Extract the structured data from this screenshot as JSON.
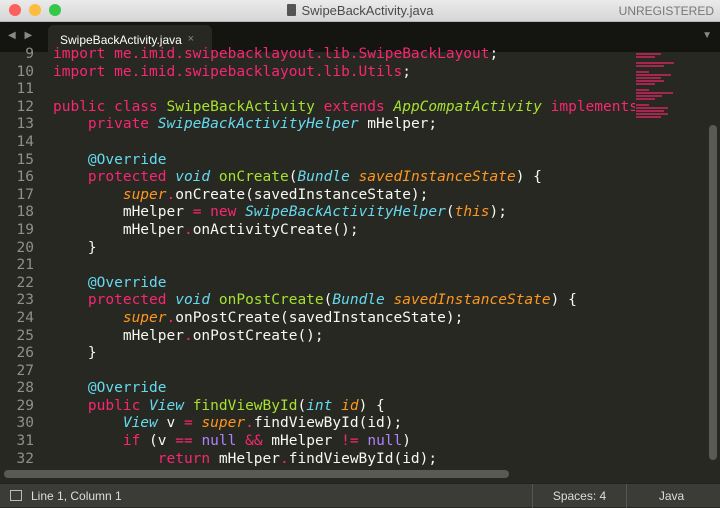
{
  "window": {
    "title": "SwipeBackActivity.java",
    "badge": "UNREGISTERED",
    "lights": [
      "#fc605b",
      "#fdbc40",
      "#34c84a"
    ]
  },
  "tabs": [
    {
      "label": "SwipeBackActivity.java",
      "close": "×"
    }
  ],
  "nav": {
    "arrows": "◀ ▶",
    "menu": "▼"
  },
  "code": [
    {
      "n": "9",
      "t": [
        [
          "import me.imid.swipebacklayout.lib.SwipeBackLayout",
          "k"
        ],
        [
          ";",
          "p"
        ]
      ]
    },
    {
      "n": "10",
      "t": [
        [
          "import me.imid.swipebacklayout.lib.Utils",
          "k"
        ],
        [
          ";",
          "p"
        ]
      ]
    },
    {
      "n": "11",
      "t": []
    },
    {
      "n": "12",
      "t": [
        [
          "public class ",
          "k"
        ],
        [
          "SwipeBackActivity ",
          "f"
        ],
        [
          "extends ",
          "k"
        ],
        [
          "AppCompatActivity ",
          "g"
        ],
        [
          "implements",
          "k"
        ]
      ]
    },
    {
      "n": "13",
      "t": [
        [
          "    private ",
          "k"
        ],
        [
          "SwipeBackActivityHelper",
          "t"
        ],
        [
          " mHelper;",
          "p"
        ]
      ]
    },
    {
      "n": "14",
      "t": []
    },
    {
      "n": "15",
      "t": [
        [
          "    @Override",
          "c"
        ]
      ]
    },
    {
      "n": "16",
      "t": [
        [
          "    protected ",
          "k"
        ],
        [
          "void ",
          "t"
        ],
        [
          "onCreate",
          "f"
        ],
        [
          "(",
          "p"
        ],
        [
          "Bundle ",
          "t"
        ],
        [
          "savedInstanceState",
          "a"
        ],
        [
          ") {",
          "p"
        ]
      ]
    },
    {
      "n": "17",
      "t": [
        [
          "        ",
          "p"
        ],
        [
          "super",
          "a"
        ],
        [
          ".",
          "k"
        ],
        [
          "onCreate(savedInstanceState);",
          "p"
        ]
      ]
    },
    {
      "n": "18",
      "t": [
        [
          "        mHelper ",
          "p"
        ],
        [
          "= new ",
          "k"
        ],
        [
          "SwipeBackActivityHelper",
          "t"
        ],
        [
          "(",
          "p"
        ],
        [
          "this",
          "a"
        ],
        [
          ");",
          "p"
        ]
      ]
    },
    {
      "n": "19",
      "t": [
        [
          "        mHelper",
          "p"
        ],
        [
          ".",
          "k"
        ],
        [
          "onActivityCreate();",
          "p"
        ]
      ]
    },
    {
      "n": "20",
      "t": [
        [
          "    }",
          "p"
        ]
      ]
    },
    {
      "n": "21",
      "t": []
    },
    {
      "n": "22",
      "t": [
        [
          "    @Override",
          "c"
        ]
      ]
    },
    {
      "n": "23",
      "t": [
        [
          "    protected ",
          "k"
        ],
        [
          "void ",
          "t"
        ],
        [
          "onPostCreate",
          "f"
        ],
        [
          "(",
          "p"
        ],
        [
          "Bundle ",
          "t"
        ],
        [
          "savedInstanceState",
          "a"
        ],
        [
          ") {",
          "p"
        ]
      ]
    },
    {
      "n": "24",
      "t": [
        [
          "        ",
          "p"
        ],
        [
          "super",
          "a"
        ],
        [
          ".",
          "k"
        ],
        [
          "onPostCreate(savedInstanceState);",
          "p"
        ]
      ]
    },
    {
      "n": "25",
      "t": [
        [
          "        mHelper",
          "p"
        ],
        [
          ".",
          "k"
        ],
        [
          "onPostCreate();",
          "p"
        ]
      ]
    },
    {
      "n": "26",
      "t": [
        [
          "    }",
          "p"
        ]
      ]
    },
    {
      "n": "27",
      "t": []
    },
    {
      "n": "28",
      "t": [
        [
          "    @Override",
          "c"
        ]
      ]
    },
    {
      "n": "29",
      "t": [
        [
          "    public ",
          "k"
        ],
        [
          "View ",
          "t"
        ],
        [
          "findViewById",
          "f"
        ],
        [
          "(",
          "p"
        ],
        [
          "int ",
          "t"
        ],
        [
          "id",
          "a"
        ],
        [
          ") {",
          "p"
        ]
      ]
    },
    {
      "n": "30",
      "t": [
        [
          "        ",
          "p"
        ],
        [
          "View",
          "t"
        ],
        [
          " v ",
          "p"
        ],
        [
          "= ",
          "k"
        ],
        [
          "super",
          "a"
        ],
        [
          ".",
          "k"
        ],
        [
          "findViewById(id);",
          "p"
        ]
      ]
    },
    {
      "n": "31",
      "t": [
        [
          "        if ",
          "k"
        ],
        [
          "(v ",
          "p"
        ],
        [
          "== ",
          "k"
        ],
        [
          "null ",
          "n"
        ],
        [
          "&& ",
          "k"
        ],
        [
          "mHelper ",
          "p"
        ],
        [
          "!= ",
          "k"
        ],
        [
          "null",
          "n"
        ],
        [
          ")",
          "p"
        ]
      ]
    },
    {
      "n": "32",
      "t": [
        [
          "            return ",
          "k"
        ],
        [
          "mHelper",
          "p"
        ],
        [
          ".",
          "k"
        ],
        [
          "findViewById(id);",
          "p"
        ]
      ]
    }
  ],
  "status": {
    "position": "Line 1, Column 1",
    "indent": "Spaces: 4",
    "syntax": "Java"
  }
}
